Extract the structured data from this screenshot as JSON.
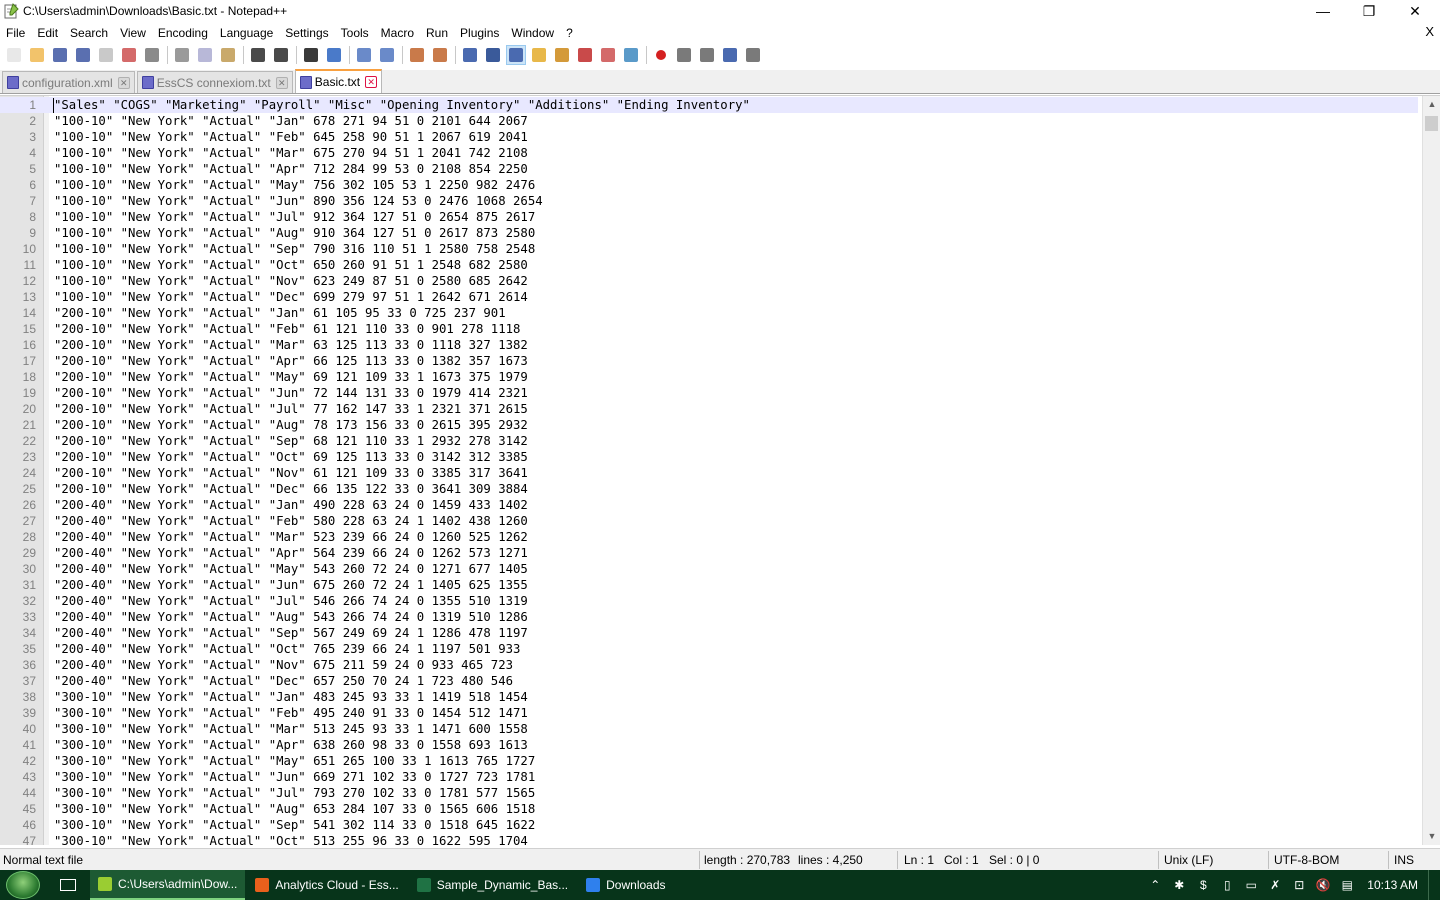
{
  "window": {
    "title": "C:\\Users\\admin\\Downloads\\Basic.txt - Notepad++",
    "minimize_glyph": "—",
    "restore_glyph": "❐",
    "close_glyph": "✕"
  },
  "menu": {
    "items": [
      "File",
      "Edit",
      "Search",
      "View",
      "Encoding",
      "Language",
      "Settings",
      "Tools",
      "Macro",
      "Run",
      "Plugins",
      "Window",
      "?"
    ],
    "close_glyph": "X"
  },
  "toolbar": {
    "buttons": [
      {
        "icon": "new-file-icon",
        "color": "#e8e8e8"
      },
      {
        "icon": "open-file-icon",
        "color": "#f2c36b"
      },
      {
        "icon": "save-icon",
        "color": "#5a6fb0"
      },
      {
        "icon": "save-all-icon",
        "color": "#5a6fb0"
      },
      {
        "icon": "close-file-icon",
        "color": "#c9c9c9"
      },
      {
        "icon": "close-all-icon",
        "color": "#d46a6a"
      },
      {
        "icon": "print-icon",
        "color": "#8a8a8a"
      },
      {
        "icon": "cut-icon",
        "color": "#9a9a9a"
      },
      {
        "icon": "copy-icon",
        "color": "#b8b8d8"
      },
      {
        "icon": "paste-icon",
        "color": "#c9a96b"
      },
      {
        "icon": "undo-icon",
        "color": "#4a4a4a"
      },
      {
        "icon": "redo-icon",
        "color": "#4a4a4a"
      },
      {
        "icon": "find-icon",
        "color": "#3a3a3a"
      },
      {
        "icon": "replace-icon",
        "color": "#4a7ac9"
      },
      {
        "icon": "zoom-in-icon",
        "color": "#6a8ac9"
      },
      {
        "icon": "zoom-out-icon",
        "color": "#6a8ac9"
      },
      {
        "icon": "sync-vertical-icon",
        "color": "#c97a4a"
      },
      {
        "icon": "sync-horizontal-icon",
        "color": "#c97a4a"
      },
      {
        "icon": "word-wrap-icon",
        "color": "#4a6ab0"
      },
      {
        "icon": "show-all-chars-icon",
        "color": "#3a5a9a"
      },
      {
        "icon": "indent-guide-icon",
        "color": "#4a6ab0"
      },
      {
        "icon": "user-language-icon",
        "color": "#e8b84a"
      },
      {
        "icon": "doc-map-icon",
        "color": "#d49a3a"
      },
      {
        "icon": "function-list-icon",
        "color": "#c94a4a"
      },
      {
        "icon": "folder-workspace-icon",
        "color": "#d46a6a"
      },
      {
        "icon": "monitoring-icon",
        "color": "#5a9ac9"
      },
      {
        "icon": "record-macro-icon",
        "color": "#d42020"
      },
      {
        "icon": "stop-macro-icon",
        "color": "#7a7a7a"
      },
      {
        "icon": "play-macro-icon",
        "color": "#7a7a7a"
      },
      {
        "icon": "run-macro-multiple-icon",
        "color": "#4a6ab0"
      },
      {
        "icon": "save-macro-icon",
        "color": "#7a7a7a"
      }
    ]
  },
  "tabs": [
    {
      "label": "configuration.xml",
      "active": false
    },
    {
      "label": "EssCS connexiom.txt",
      "active": false
    },
    {
      "label": "Basic.txt",
      "active": true
    }
  ],
  "editor": {
    "lines": [
      "\"Sales\" \"COGS\" \"Marketing\" \"Payroll\" \"Misc\" \"Opening Inventory\" \"Additions\" \"Ending Inventory\"",
      "\"100-10\" \"New York\" \"Actual\" \"Jan\" 678 271 94 51 0 2101 644 2067",
      "\"100-10\" \"New York\" \"Actual\" \"Feb\" 645 258 90 51 1 2067 619 2041",
      "\"100-10\" \"New York\" \"Actual\" \"Mar\" 675 270 94 51 1 2041 742 2108",
      "\"100-10\" \"New York\" \"Actual\" \"Apr\" 712 284 99 53 0 2108 854 2250",
      "\"100-10\" \"New York\" \"Actual\" \"May\" 756 302 105 53 1 2250 982 2476",
      "\"100-10\" \"New York\" \"Actual\" \"Jun\" 890 356 124 53 0 2476 1068 2654",
      "\"100-10\" \"New York\" \"Actual\" \"Jul\" 912 364 127 51 0 2654 875 2617",
      "\"100-10\" \"New York\" \"Actual\" \"Aug\" 910 364 127 51 0 2617 873 2580",
      "\"100-10\" \"New York\" \"Actual\" \"Sep\" 790 316 110 51 1 2580 758 2548",
      "\"100-10\" \"New York\" \"Actual\" \"Oct\" 650 260 91 51 1 2548 682 2580",
      "\"100-10\" \"New York\" \"Actual\" \"Nov\" 623 249 87 51 0 2580 685 2642",
      "\"100-10\" \"New York\" \"Actual\" \"Dec\" 699 279 97 51 1 2642 671 2614",
      "\"200-10\" \"New York\" \"Actual\" \"Jan\" 61 105 95 33 0 725 237 901",
      "\"200-10\" \"New York\" \"Actual\" \"Feb\" 61 121 110 33 0 901 278 1118",
      "\"200-10\" \"New York\" \"Actual\" \"Mar\" 63 125 113 33 0 1118 327 1382",
      "\"200-10\" \"New York\" \"Actual\" \"Apr\" 66 125 113 33 0 1382 357 1673",
      "\"200-10\" \"New York\" \"Actual\" \"May\" 69 121 109 33 1 1673 375 1979",
      "\"200-10\" \"New York\" \"Actual\" \"Jun\" 72 144 131 33 0 1979 414 2321",
      "\"200-10\" \"New York\" \"Actual\" \"Jul\" 77 162 147 33 1 2321 371 2615",
      "\"200-10\" \"New York\" \"Actual\" \"Aug\" 78 173 156 33 0 2615 395 2932",
      "\"200-10\" \"New York\" \"Actual\" \"Sep\" 68 121 110 33 1 2932 278 3142",
      "\"200-10\" \"New York\" \"Actual\" \"Oct\" 69 125 113 33 0 3142 312 3385",
      "\"200-10\" \"New York\" \"Actual\" \"Nov\" 61 121 109 33 0 3385 317 3641",
      "\"200-10\" \"New York\" \"Actual\" \"Dec\" 66 135 122 33 0 3641 309 3884",
      "\"200-40\" \"New York\" \"Actual\" \"Jan\" 490 228 63 24 0 1459 433 1402",
      "\"200-40\" \"New York\" \"Actual\" \"Feb\" 580 228 63 24 1 1402 438 1260",
      "\"200-40\" \"New York\" \"Actual\" \"Mar\" 523 239 66 24 0 1260 525 1262",
      "\"200-40\" \"New York\" \"Actual\" \"Apr\" 564 239 66 24 0 1262 573 1271",
      "\"200-40\" \"New York\" \"Actual\" \"May\" 543 260 72 24 0 1271 677 1405",
      "\"200-40\" \"New York\" \"Actual\" \"Jun\" 675 260 72 24 1 1405 625 1355",
      "\"200-40\" \"New York\" \"Actual\" \"Jul\" 546 266 74 24 0 1355 510 1319",
      "\"200-40\" \"New York\" \"Actual\" \"Aug\" 543 266 74 24 0 1319 510 1286",
      "\"200-40\" \"New York\" \"Actual\" \"Sep\" 567 249 69 24 1 1286 478 1197",
      "\"200-40\" \"New York\" \"Actual\" \"Oct\" 765 239 66 24 1 1197 501 933",
      "\"200-40\" \"New York\" \"Actual\" \"Nov\" 675 211 59 24 0 933 465 723",
      "\"200-40\" \"New York\" \"Actual\" \"Dec\" 657 250 70 24 1 723 480 546",
      "\"300-10\" \"New York\" \"Actual\" \"Jan\" 483 245 93 33 1 1419 518 1454",
      "\"300-10\" \"New York\" \"Actual\" \"Feb\" 495 240 91 33 0 1454 512 1471",
      "\"300-10\" \"New York\" \"Actual\" \"Mar\" 513 245 93 33 1 1471 600 1558",
      "\"300-10\" \"New York\" \"Actual\" \"Apr\" 638 260 98 33 0 1558 693 1613",
      "\"300-10\" \"New York\" \"Actual\" \"May\" 651 265 100 33 1 1613 765 1727",
      "\"300-10\" \"New York\" \"Actual\" \"Jun\" 669 271 102 33 0 1727 723 1781",
      "\"300-10\" \"New York\" \"Actual\" \"Jul\" 793 270 102 33 0 1781 577 1565",
      "\"300-10\" \"New York\" \"Actual\" \"Aug\" 653 284 107 33 0 1565 606 1518",
      "\"300-10\" \"New York\" \"Actual\" \"Sep\" 541 302 114 33 0 1518 645 1622",
      "\"300-10\" \"New York\" \"Actual\" \"Oct\" 513 255 96 33 0 1622 595 1704"
    ]
  },
  "statusbar": {
    "file_type": "Normal text file",
    "length": "length : 270,783",
    "lines": "lines : 4,250",
    "ln": "Ln : 1",
    "col": "Col : 1",
    "sel": "Sel : 0 | 0",
    "eol": "Unix (LF)",
    "encoding": "UTF-8-BOM",
    "mode": "INS"
  },
  "taskbar": {
    "tasks": [
      {
        "label": "C:\\Users\\admin\\Dow...",
        "icon": "notepadpp-icon",
        "color": "#9acd32",
        "active": true
      },
      {
        "label": "Analytics Cloud - Ess...",
        "icon": "firefox-icon",
        "color": "#e8601c",
        "active": false
      },
      {
        "label": "Sample_Dynamic_Bas...",
        "icon": "excel-icon",
        "color": "#1f7244",
        "active": false
      },
      {
        "label": "Downloads",
        "icon": "download-folder-icon",
        "color": "#2f80ed",
        "active": false
      }
    ],
    "tray_icons": [
      "chevron-up-icon",
      "settings-gear-icon",
      "sync-icon",
      "battery-icon",
      "vm-icon",
      "network-warning-icon",
      "display-icon",
      "volume-mute-icon",
      "action-center-icon"
    ],
    "tray_glyphs": [
      "⌃",
      "✱",
      "$",
      "▯",
      "▭",
      "✗",
      "⊡",
      "🔇",
      "▤"
    ],
    "time": "10:13 AM"
  }
}
